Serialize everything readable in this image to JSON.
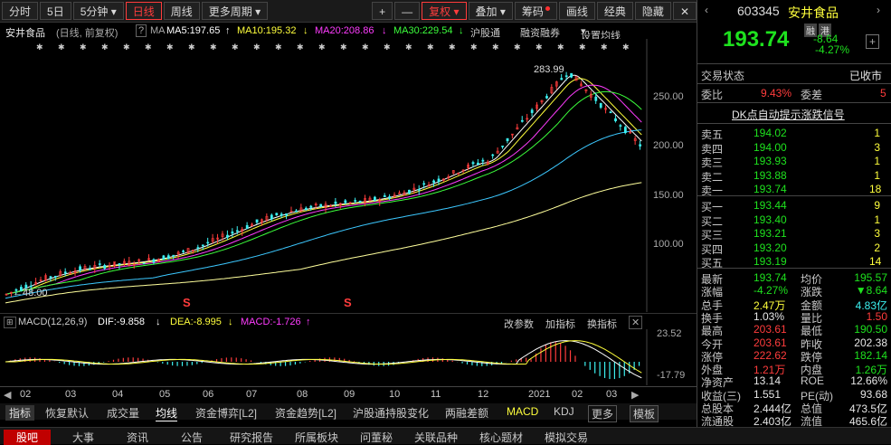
{
  "toolbar": {
    "tabs": [
      "分时",
      "5日",
      "5分钟",
      "日线",
      "周线",
      "更多周期"
    ],
    "right": [
      "+",
      "—",
      "复权",
      "叠加",
      "筹码",
      "画线",
      "经典",
      "隐藏"
    ]
  },
  "info": {
    "name": "安井食品",
    "mode": "(日线, 前复权)",
    "ma_label": "MA",
    "ma5": "MA5:197.65",
    "ma10": "MA10:195.32",
    "ma20": "MA20:208.86",
    "ma30": "MA30:229.54",
    "hgt": "沪股通",
    "rzrq": "融资融券",
    "set_ma": "设置均线"
  },
  "chart": {
    "high_label": "283.99",
    "low_label": "48.00",
    "y_ticks": [
      "250.00",
      "200.00",
      "150.00",
      "100.00"
    ],
    "s_marks": [
      "S",
      "S"
    ]
  },
  "macd": {
    "title": "MACD(12,26,9)",
    "dif": "DIF:-9.858",
    "dea": "DEA:-8.995",
    "macd": "MACD:-1.726",
    "btn_params": "改参数",
    "btn_add": "加指标",
    "btn_switch": "换指标",
    "y_top": "23.52",
    "y_bottom": "-17.79"
  },
  "time_axis": [
    "02",
    "03",
    "04",
    "05",
    "06",
    "07",
    "08",
    "09",
    "10",
    "11",
    "12",
    "2021",
    "02",
    "03"
  ],
  "indicator_tabs": [
    "指标",
    "恢复默认",
    "成交量",
    "均线",
    "资金博弈[L2]",
    "资金趋势[L2]",
    "沪股通持股变化",
    "两融差额",
    "MACD",
    "KDJ",
    "更多",
    "模板"
  ],
  "bottom_tabs": [
    "股吧",
    "大事",
    "资讯",
    "公告",
    "研究报告",
    "所属板块",
    "问董秘",
    "关联品种",
    "核心题材",
    "模拟交易"
  ],
  "quote": {
    "code": "603345",
    "name": "安井食品",
    "price": "193.74",
    "badge1": "融",
    "badge2": "港",
    "change": "-8.64",
    "change_pct": "-4.27%",
    "status_label": "交易状态",
    "status_value": "已收市",
    "wb_label": "委比",
    "wb_value": "9.43%",
    "wc_label": "委差",
    "wc_value": "5",
    "dk_link": "DK点自动提示涨跌信号",
    "asks": [
      {
        "label": "卖五",
        "price": "194.02",
        "vol": "1"
      },
      {
        "label": "卖四",
        "price": "194.00",
        "vol": "3"
      },
      {
        "label": "卖三",
        "price": "193.93",
        "vol": "1"
      },
      {
        "label": "卖二",
        "price": "193.88",
        "vol": "1"
      },
      {
        "label": "卖一",
        "price": "193.74",
        "vol": "18"
      }
    ],
    "bids": [
      {
        "label": "买一",
        "price": "193.44",
        "vol": "9"
      },
      {
        "label": "买二",
        "price": "193.40",
        "vol": "1"
      },
      {
        "label": "买三",
        "price": "193.21",
        "vol": "3"
      },
      {
        "label": "买四",
        "price": "193.20",
        "vol": "2"
      },
      {
        "label": "买五",
        "price": "193.19",
        "vol": "14"
      }
    ],
    "stats": [
      {
        "l1": "最新",
        "v1": "193.74",
        "c1": "green",
        "l2": "均价",
        "v2": "195.57",
        "c2": "green"
      },
      {
        "l1": "涨幅",
        "v1": "-4.27%",
        "c1": "green",
        "l2": "涨跌",
        "v2": "▼8.64",
        "c2": "green"
      },
      {
        "l1": "总手",
        "v1": "2.47万",
        "c1": "yellow",
        "l2": "金额",
        "v2": "4.83亿",
        "c2": "cyan"
      },
      {
        "l1": "换手",
        "v1": "1.03%",
        "c1": "white",
        "l2": "量比",
        "v2": "1.50",
        "c2": "red"
      },
      {
        "l1": "最高",
        "v1": "203.61",
        "c1": "red",
        "l2": "最低",
        "v2": "190.50",
        "c2": "green"
      },
      {
        "l1": "今开",
        "v1": "203.61",
        "c1": "red",
        "l2": "昨收",
        "v2": "202.38",
        "c2": "white"
      },
      {
        "l1": "涨停",
        "v1": "222.62",
        "c1": "red",
        "l2": "跌停",
        "v2": "182.14",
        "c2": "green"
      },
      {
        "l1": "外盘",
        "v1": "1.21万",
        "c1": "red",
        "l2": "内盘",
        "v2": "1.26万",
        "c2": "green"
      },
      {
        "l1": "净资产",
        "v1": "13.14",
        "c1": "white",
        "l2": "ROE",
        "v2": "12.66%",
        "c2": "white"
      },
      {
        "l1": "收益(三)",
        "v1": "1.551",
        "c1": "white",
        "l2": "PE(动)",
        "v2": "93.68",
        "c2": "white"
      },
      {
        "l1": "总股本",
        "v1": "2.444亿",
        "c1": "white",
        "l2": "总值",
        "v2": "473.5亿",
        "c2": "white"
      },
      {
        "l1": "流通股",
        "v1": "2.403亿",
        "c1": "white",
        "l2": "流值",
        "v2": "465.6亿",
        "c2": "white"
      }
    ]
  },
  "colors": {
    "up": "#ff3c3c",
    "down": "#1ee21e",
    "ma5": "#ffffff",
    "ma10": "#ffff3c",
    "ma20": "#ff3cff",
    "ma30": "#3cff3c"
  }
}
